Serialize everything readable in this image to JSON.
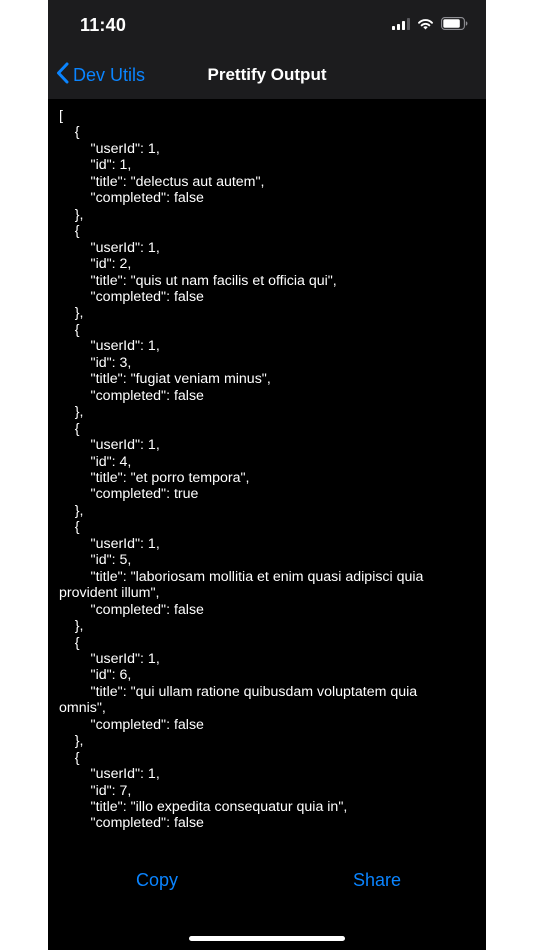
{
  "status_bar": {
    "time": "11:40",
    "icons": [
      "cellular-signal-icon",
      "wifi-icon",
      "battery-icon"
    ]
  },
  "nav": {
    "back_label": "Dev Utils",
    "title": "Prettify Output"
  },
  "output_text": "[\n    {\n        \"userId\": 1,\n        \"id\": 1,\n        \"title\": \"delectus aut autem\",\n        \"completed\": false\n    },\n    {\n        \"userId\": 1,\n        \"id\": 2,\n        \"title\": \"quis ut nam facilis et officia qui\",\n        \"completed\": false\n    },\n    {\n        \"userId\": 1,\n        \"id\": 3,\n        \"title\": \"fugiat veniam minus\",\n        \"completed\": false\n    },\n    {\n        \"userId\": 1,\n        \"id\": 4,\n        \"title\": \"et porro tempora\",\n        \"completed\": true\n    },\n    {\n        \"userId\": 1,\n        \"id\": 5,\n        \"title\": \"laboriosam mollitia et enim quasi adipisci quia\nprovident illum\",\n        \"completed\": false\n    },\n    {\n        \"userId\": 1,\n        \"id\": 6,\n        \"title\": \"qui ullam ratione quibusdam voluptatem quia\nomnis\",\n        \"completed\": false\n    },\n    {\n        \"userId\": 1,\n        \"id\": 7,\n        \"title\": \"illo expedita consequatur quia in\",\n        \"completed\": false",
  "actions": {
    "copy_label": "Copy",
    "share_label": "Share"
  },
  "colors": {
    "accent": "#0a84ff",
    "background": "#000000",
    "bar_background": "#1c1c1e",
    "text": "#ffffff"
  }
}
